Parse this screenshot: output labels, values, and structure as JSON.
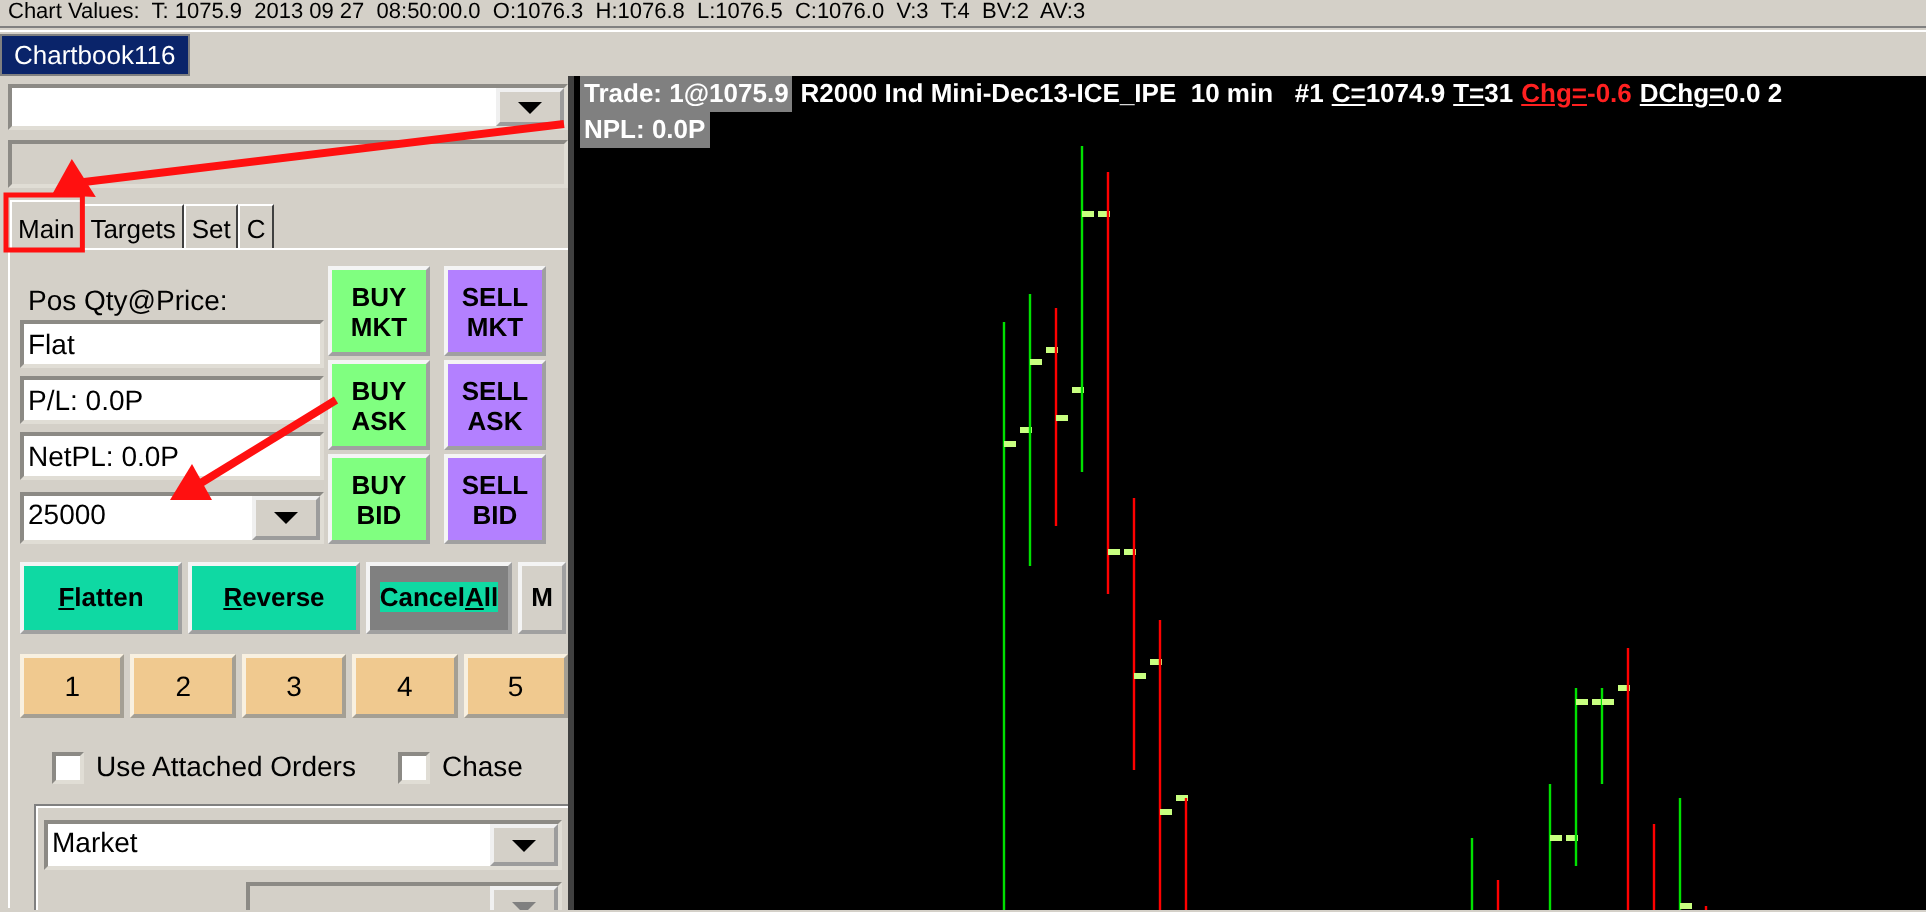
{
  "chart_values_bar": {
    "text": "Chart Values:  T: 1075.9  2013 09 27  08:50:00.0  O:1076.3  H:1076.8  L:1076.5  C:1076.0  V:3  T:4  BV:2  AV:3"
  },
  "chartbook_tabs": [
    {
      "label": "Chartbook116",
      "selected": true
    }
  ],
  "trade_panel": {
    "tabs": [
      {
        "label": "Main",
        "selected": true
      },
      {
        "label": "Targets",
        "selected": false
      },
      {
        "label": "Set",
        "selected": false
      },
      {
        "label": "C",
        "selected": false
      }
    ],
    "position_label": "Pos Qty@Price:",
    "fields": [
      "Flat",
      "P/L: 0.0P",
      "NetPL: 0.0P"
    ],
    "quantity": "25000",
    "order_buttons": [
      {
        "kind": "buy",
        "lines": [
          "BUY",
          "MKT"
        ]
      },
      {
        "kind": "sell",
        "lines": [
          "SELL",
          "MKT"
        ]
      },
      {
        "kind": "buy",
        "lines": [
          "BUY",
          "ASK"
        ]
      },
      {
        "kind": "sell",
        "lines": [
          "SELL",
          "ASK"
        ]
      },
      {
        "kind": "buy",
        "lines": [
          "BUY",
          "BID"
        ]
      },
      {
        "kind": "sell",
        "lines": [
          "SELL",
          "BID"
        ]
      }
    ],
    "action_buttons": [
      {
        "kind": "action",
        "key": "F",
        "after": "latten"
      },
      {
        "kind": "action",
        "key": "R",
        "after": "everse"
      },
      {
        "kind": "cancel",
        "before": "Cancel",
        "key": "A",
        "after": "ll"
      },
      {
        "kind": "plain",
        "before": "M"
      }
    ],
    "quick_buttons": [
      "1",
      "2",
      "3",
      "4",
      "5"
    ],
    "checkboxes": [
      {
        "label": "Use Attached Orders",
        "checked": false
      },
      {
        "label": "Chase",
        "checked": false
      }
    ],
    "order_combos": [
      {
        "value": "Market",
        "disabled": false
      },
      {
        "disabled": true
      }
    ]
  },
  "chart": {
    "header_lines": [
      [
        {
          "kind": "boxed",
          "text": "Trade: 1@1075.9"
        },
        {
          "kind": "plain",
          "text": "R2000 Ind Mini-Dec13-ICE_IPE  10 min   #1"
        },
        {
          "kind": "label",
          "text": "C="
        },
        {
          "kind": "plain",
          "text": "1074.9"
        },
        {
          "kind": "label",
          "text": "T="
        },
        {
          "kind": "plain",
          "text": "31"
        },
        {
          "kind": "alert_label",
          "text": "Chg="
        },
        {
          "kind": "alert",
          "text": "-0.6"
        },
        {
          "kind": "label",
          "text": "DChg="
        },
        {
          "kind": "plain",
          "text": "0.0 2"
        }
      ],
      [
        {
          "kind": "boxed",
          "text": "NPL: 0.0P"
        }
      ]
    ]
  }
}
